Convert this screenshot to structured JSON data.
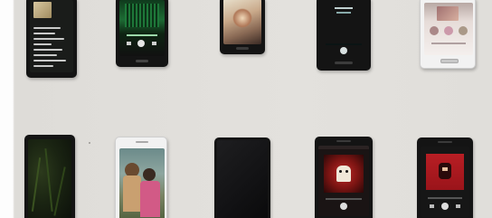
{
  "scene": {
    "description_label": "",
    "wall_color": "#e1dfdb",
    "device_count": 10
  },
  "top_row": {
    "phones": [
      {
        "id": "p1",
        "body": "black",
        "content": "lyrics-screen"
      },
      {
        "id": "p2",
        "body": "black",
        "content": "green-music-player"
      },
      {
        "id": "p3",
        "body": "black",
        "content": "photo-album-art"
      },
      {
        "id": "p4",
        "body": "black",
        "content": "teal-player"
      },
      {
        "id": "p5",
        "body": "white",
        "content": "pale-player"
      }
    ]
  },
  "bottom_row": {
    "phones": [
      {
        "id": "p6",
        "body": "black",
        "content": "dark-forest-screen"
      },
      {
        "id": "p7",
        "body": "white",
        "content": "couple-photo"
      },
      {
        "id": "p8",
        "body": "black",
        "content": "blank-screen"
      },
      {
        "id": "p9",
        "body": "black",
        "content": "red-album-art"
      },
      {
        "id": "p10",
        "body": "black",
        "content": "red-album-art-2"
      }
    ]
  }
}
